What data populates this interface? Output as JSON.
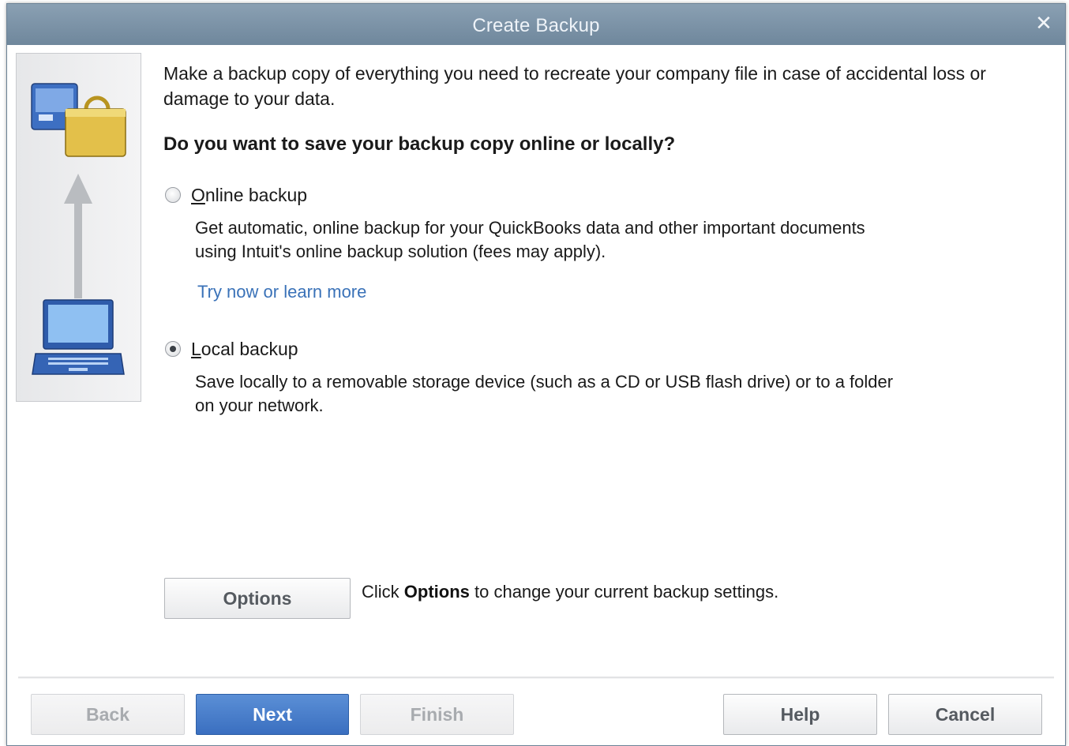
{
  "window": {
    "title": "Create Backup",
    "close_glyph": "✕"
  },
  "intro_text": "Make a backup copy of everything you need to recreate your company file in case of accidental loss or damage to your data.",
  "question": "Do you want to save your backup copy online or locally?",
  "options": {
    "online": {
      "label": "Online backup",
      "underline_char": "O",
      "selected": false,
      "description": "Get automatic, online backup for your QuickBooks data and other important documents using Intuit's online backup solution (fees may apply).",
      "link": "Try now or learn more"
    },
    "local": {
      "label": "Local backup",
      "underline_char": "L",
      "selected": true,
      "description": "Save locally to a removable storage device (such as a CD or USB flash drive) or to a folder on your network."
    }
  },
  "options_button": {
    "label": "Options",
    "note_prefix": "Click ",
    "note_bold": "Options",
    "note_suffix": " to change your current backup settings."
  },
  "footer": {
    "back": "Back",
    "next": "Next",
    "finish": "Finish",
    "help": "Help",
    "cancel": "Cancel"
  },
  "colors": {
    "titlebar": "#7990a5",
    "link": "#3a72b8",
    "primary_button": "#4a7fcb"
  },
  "icons": [
    "briefcase-lock-icon",
    "up-arrow-icon",
    "laptop-icon"
  ]
}
